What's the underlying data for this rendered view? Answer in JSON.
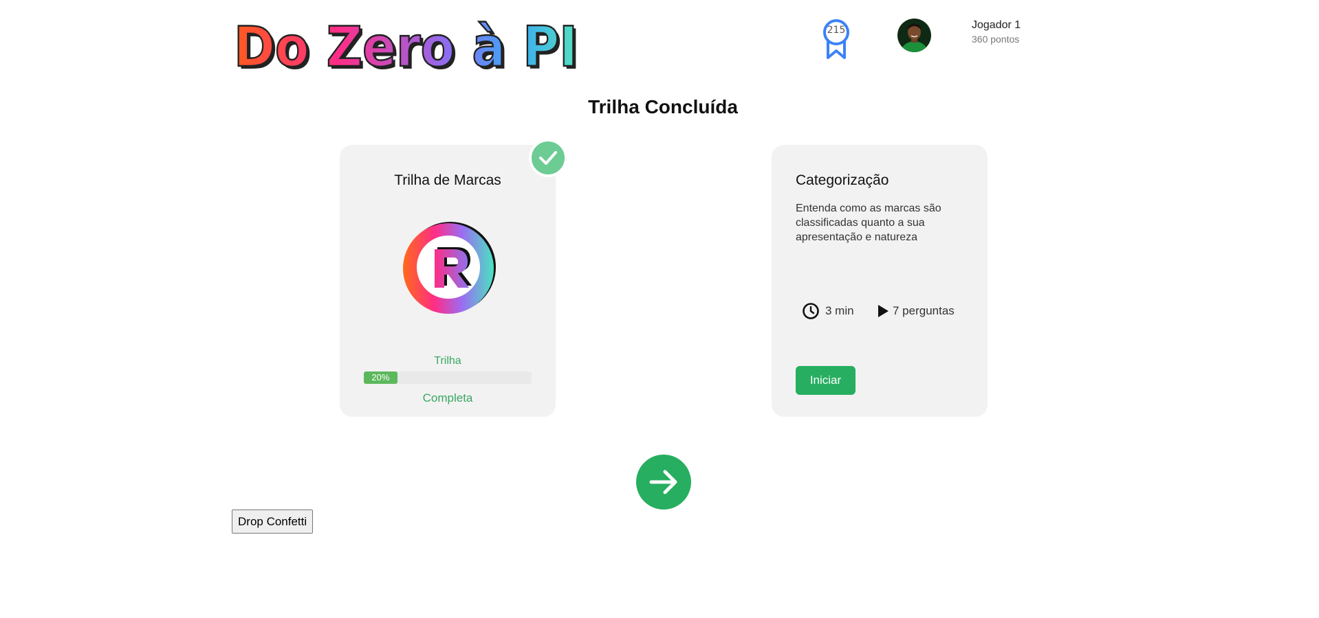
{
  "header": {
    "logo_text": "Do Zero à PI",
    "badge_count": "215",
    "player_name": "Jogador 1",
    "player_points": "360 pontos"
  },
  "page_title": "Trilha Concluída",
  "completed_card": {
    "title": "Trilha de Marcas",
    "trail_label": "Trilha",
    "progress_label": "20%",
    "progress_value": 0.2,
    "complete_label": "Completa"
  },
  "next_card": {
    "title": "Categorização",
    "description": "Entenda como as marcas são classificadas quanto a sua apresentação e natureza",
    "duration": "3 min",
    "questions": "7 perguntas",
    "start_label": "Iniciar"
  },
  "confetti_label": "Drop Confetti",
  "colors": {
    "accent_green": "#27ae60",
    "progress_green": "#5cb85c",
    "check_green": "#6ccc93",
    "badge_blue": "#3b82f6"
  },
  "icons": {
    "badge": "award-ribbon-icon",
    "check": "check-icon",
    "time": "clock-icon",
    "questions": "play-icon",
    "next": "arrow-right-icon"
  }
}
